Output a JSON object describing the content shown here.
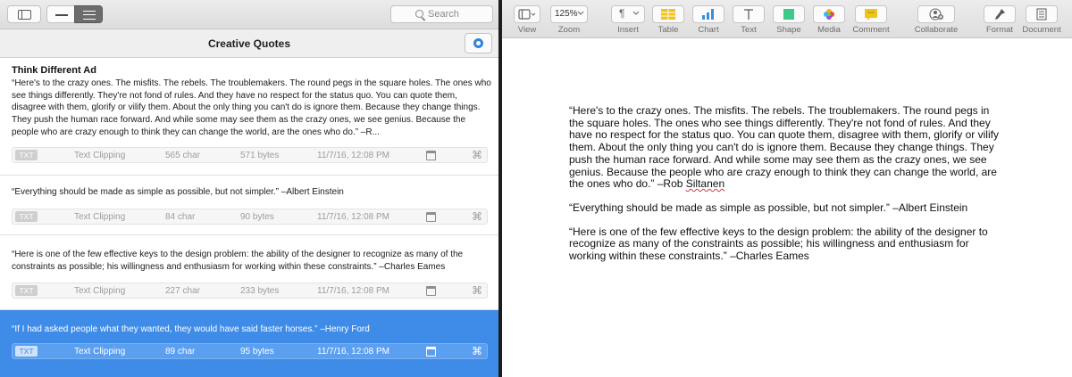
{
  "search": {
    "placeholder": "Search"
  },
  "list": {
    "title": "Creative Quotes",
    "clips": [
      {
        "title": "Think Different Ad",
        "text": "“Here's to the crazy ones. The misfits. The rebels. The troublemakers. The round pegs in the square holes. The ones who see things differently. They're not fond of rules. And they have no respect for the status quo. You can quote them, disagree with them, glorify or vilify them. About the only thing you can't do is ignore them. Because they change things. They push the human race forward. And while some may see them as the crazy ones, we see genius. Because the people who are crazy enough to think they can change the world, are the ones who do.” –R...",
        "badge": "TXT",
        "kind": "Text Clipping",
        "chars": "565 char",
        "bytes": "571 bytes",
        "date": "11/7/16, 12:08 PM",
        "selected": false
      },
      {
        "title": "",
        "text": "“Everything should be made as simple as possible, but not simpler.” –Albert Einstein",
        "badge": "TXT",
        "kind": "Text Clipping",
        "chars": "84 char",
        "bytes": "90 bytes",
        "date": "11/7/16, 12:08 PM",
        "selected": false
      },
      {
        "title": "",
        "text": "“Here is one of the few effective keys to the design problem: the ability of the designer to recognize as many of the constraints as possible; his willingness and enthusiasm for working within these constraints.” –Charles Eames",
        "badge": "TXT",
        "kind": "Text Clipping",
        "chars": "227 char",
        "bytes": "233 bytes",
        "date": "11/7/16, 12:08 PM",
        "selected": false
      },
      {
        "title": "",
        "text": "“If I had asked people what they wanted, they would have said faster horses.” –Henry Ford",
        "badge": "TXT",
        "kind": "Text Clipping",
        "chars": "89 char",
        "bytes": "95 bytes",
        "date": "11/7/16, 12:08 PM",
        "selected": true
      }
    ]
  },
  "pages_toolbar": {
    "zoom_value": "125%",
    "tools": [
      {
        "label": "View",
        "icon": "view-icon"
      },
      {
        "label": "Zoom",
        "icon": "zoom-menu"
      },
      {
        "label": "Insert",
        "icon": "pilcrow-icon"
      },
      {
        "label": "Table",
        "icon": "table-icon"
      },
      {
        "label": "Chart",
        "icon": "chart-icon"
      },
      {
        "label": "Text",
        "icon": "text-icon"
      },
      {
        "label": "Shape",
        "icon": "shape-icon"
      },
      {
        "label": "Media",
        "icon": "media-icon"
      },
      {
        "label": "Comment",
        "icon": "comment-icon"
      },
      {
        "label": "Collaborate",
        "icon": "collaborate-icon"
      },
      {
        "label": "Format",
        "icon": "format-brush-icon"
      },
      {
        "label": "Document",
        "icon": "document-icon"
      }
    ],
    "colors": {
      "table": "#f3c21a",
      "chart": "#3a8fdd",
      "shape": "#3cc98a",
      "comment": "#f0c419"
    }
  },
  "document": {
    "p1_main": "“Here's to the crazy ones. The misfits. The rebels. The troublemakers. The round pegs in the square holes. The ones who see things differently. They're not fond of rules. And they have no respect for the status quo. You can quote them, disagree with them, glorify or vilify them. About the only thing you can't do is ignore them. Because they change things. They push the human race forward. And while some may see them as the crazy ones, we see genius. Because the people who are crazy enough to think they can change the world, are the ones who do.” –Rob",
    "p1_misspelled": "Siltanen",
    "p2": "“Everything should be made as simple as possible, but not simpler.” –Albert Einstein",
    "p3": "“Here is one of the few effective keys to the design problem: the ability of the designer to recognize as many of the constraints as possible; his willingness and enthusiasm for working within these constraints.” –Charles Eames"
  }
}
